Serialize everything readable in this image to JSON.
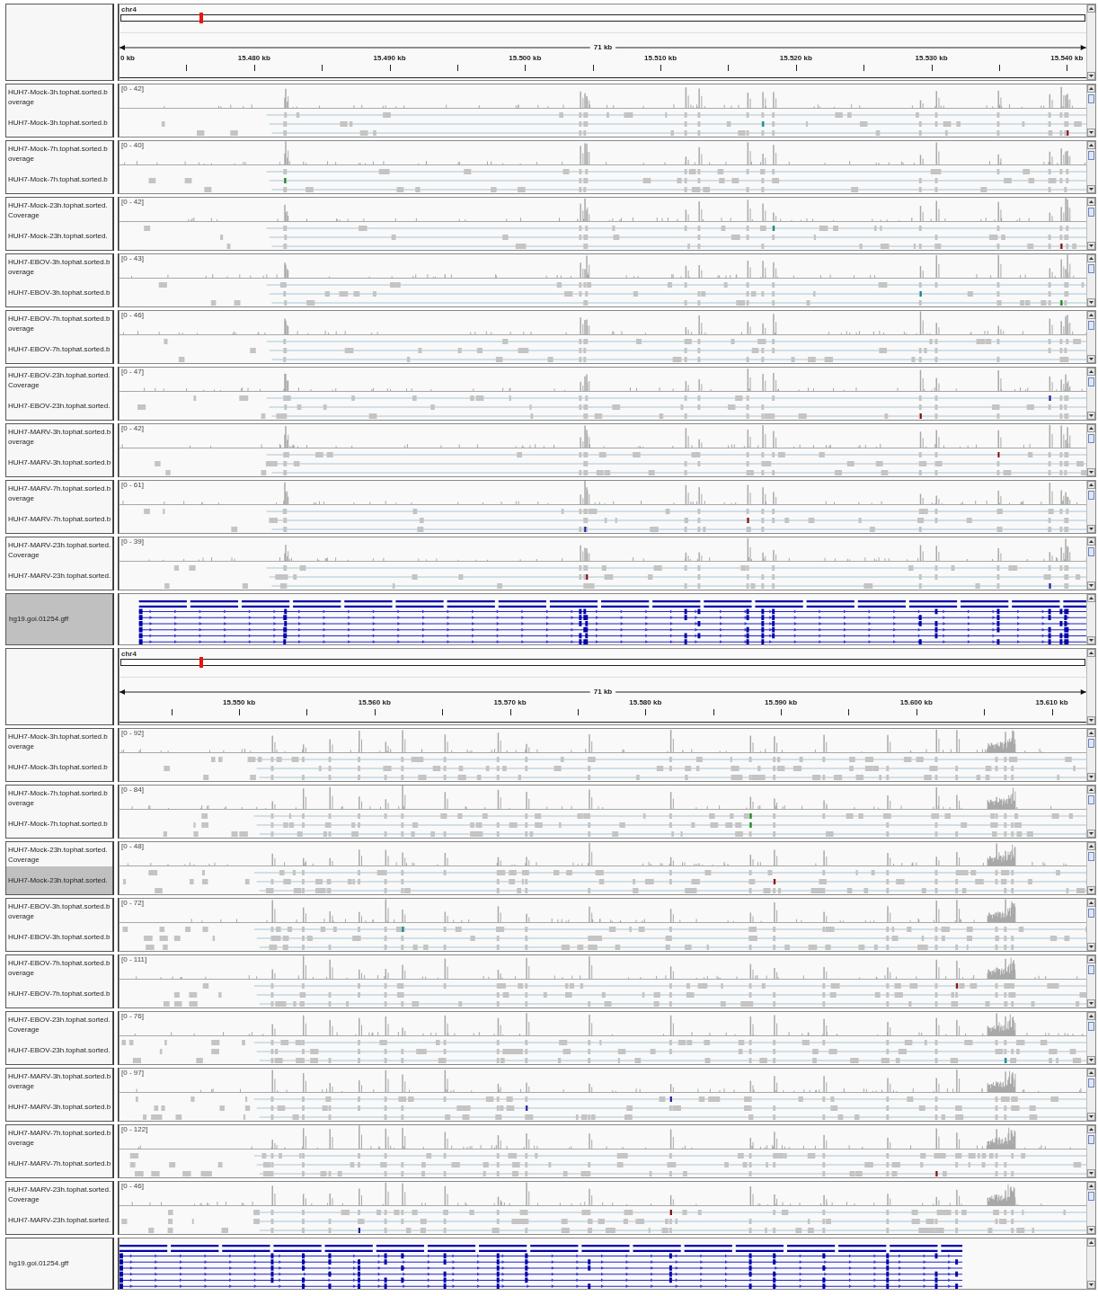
{
  "panels": [
    {
      "chromosome": "chr4",
      "span": "71 kb",
      "ruler_ticks": [
        "0 kb",
        "15.480 kb",
        "15.490 kb",
        "15.500 kb",
        "15.510 kb",
        "15.520 kb",
        "15.530 kb",
        "15.540 kb"
      ],
      "tracks": [
        {
          "coverage_label_line_1": "HUH7-Mock-3h.tophat.sorted.b",
          "coverage_label_line_2": "overage",
          "reads_label": "HUH7-Mock-3h.tophat.sorted.b",
          "range": "[0 - 42]",
          "reads_selected": false
        },
        {
          "coverage_label_line_1": "HUH7-Mock-7h.tophat.sorted.b",
          "coverage_label_line_2": "overage",
          "reads_label": "HUH7-Mock-7h.tophat.sorted.b",
          "range": "[0 - 40]",
          "reads_selected": false
        },
        {
          "coverage_label_line_1": "HUH7-Mock-23h.tophat.sorted.",
          "coverage_label_line_2": "Coverage",
          "reads_label": "HUH7-Mock-23h.tophat.sorted.",
          "range": "[0 - 42]",
          "reads_selected": false
        },
        {
          "coverage_label_line_1": "HUH7-EBOV-3h.tophat.sorted.b",
          "coverage_label_line_2": "overage",
          "reads_label": "HUH7-EBOV-3h.tophat.sorted.b",
          "range": "[0 - 43]",
          "reads_selected": false
        },
        {
          "coverage_label_line_1": "HUH7-EBOV-7h.tophat.sorted.b",
          "coverage_label_line_2": "overage",
          "reads_label": "HUH7-EBOV-7h.tophat.sorted.b",
          "range": "[0 - 46]",
          "reads_selected": false
        },
        {
          "coverage_label_line_1": "HUH7-EBOV-23h.tophat.sorted.",
          "coverage_label_line_2": "Coverage",
          "reads_label": "HUH7-EBOV-23h.tophat.sorted.",
          "range": "[0 - 47]",
          "reads_selected": false
        },
        {
          "coverage_label_line_1": "HUH7-MARV-3h.tophat.sorted.b",
          "coverage_label_line_2": "overage",
          "reads_label": "HUH7-MARV-3h.tophat.sorted.b",
          "range": "[0 - 42]",
          "reads_selected": false
        },
        {
          "coverage_label_line_1": "HUH7-MARV-7h.tophat.sorted.b",
          "coverage_label_line_2": "overage",
          "reads_label": "HUH7-MARV-7h.tophat.sorted.b",
          "range": "[0 - 61]",
          "reads_selected": false
        },
        {
          "coverage_label_line_1": "HUH7-MARV-23h.tophat.sorted.",
          "coverage_label_line_2": "Coverage",
          "reads_label": "HUH7-MARV-23h.tophat.sorted.",
          "range": "[0 - 39]",
          "reads_selected": false
        }
      ],
      "annotation": {
        "label": "hg19.goi.01254.gff",
        "selected": true
      }
    },
    {
      "chromosome": "chr4",
      "span": "71 kb",
      "ruler_ticks": [
        "15.550 kb",
        "15.560 kb",
        "15.570 kb",
        "15.580 kb",
        "15.590 kb",
        "15.600 kb",
        "15.610 kb"
      ],
      "tracks": [
        {
          "coverage_label_line_1": "HUH7-Mock-3h.tophat.sorted.b",
          "coverage_label_line_2": "overage",
          "reads_label": "HUH7-Mock-3h.tophat.sorted.b",
          "range": "[0 - 92]",
          "reads_selected": false
        },
        {
          "coverage_label_line_1": "HUH7-Mock-7h.tophat.sorted.b",
          "coverage_label_line_2": "overage",
          "reads_label": "HUH7-Mock-7h.tophat.sorted.b",
          "range": "[0 - 84]",
          "reads_selected": false
        },
        {
          "coverage_label_line_1": "HUH7-Mock-23h.tophat.sorted.",
          "coverage_label_line_2": "Coverage",
          "reads_label": "HUH7-Mock-23h.tophat.sorted.",
          "range": "[0 - 48]",
          "reads_selected": true
        },
        {
          "coverage_label_line_1": "HUH7-EBOV-3h.tophat.sorted.b",
          "coverage_label_line_2": "overage",
          "reads_label": "HUH7-EBOV-3h.tophat.sorted.b",
          "range": "[0 - 72]",
          "reads_selected": false
        },
        {
          "coverage_label_line_1": "HUH7-EBOV-7h.tophat.sorted.b",
          "coverage_label_line_2": "overage",
          "reads_label": "HUH7-EBOV-7h.tophat.sorted.b",
          "range": "[0 - 111]",
          "reads_selected": false
        },
        {
          "coverage_label_line_1": "HUH7-EBOV-23h.tophat.sorted.",
          "coverage_label_line_2": "Coverage",
          "reads_label": "HUH7-EBOV-23h.tophat.sorted.",
          "range": "[0 - 76]",
          "reads_selected": false
        },
        {
          "coverage_label_line_1": "HUH7-MARV-3h.tophat.sorted.b",
          "coverage_label_line_2": "overage",
          "reads_label": "HUH7-MARV-3h.tophat.sorted.b",
          "range": "[0 - 97]",
          "reads_selected": false
        },
        {
          "coverage_label_line_1": "HUH7-MARV-7h.tophat.sorted.b",
          "coverage_label_line_2": "overage",
          "reads_label": "HUH7-MARV-7h.tophat.sorted.b",
          "range": "[0 - 122]",
          "reads_selected": false
        },
        {
          "coverage_label_line_1": "HUH7-MARV-23h.tophat.sorted.",
          "coverage_label_line_2": "Coverage",
          "reads_label": "HUH7-MARV-23h.tophat.sorted.",
          "range": "[0 - 46]",
          "reads_selected": false
        }
      ],
      "annotation": {
        "label": "hg19.goi.01254.gff",
        "selected": false
      }
    }
  ]
}
